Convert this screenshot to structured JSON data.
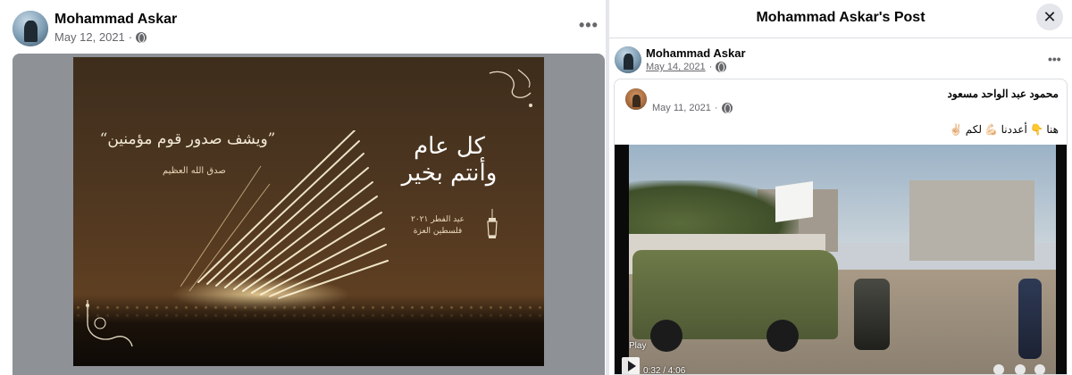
{
  "left_post": {
    "author": "Mohammad Askar",
    "date": "May 12, 2021",
    "separator": "·",
    "more": "•••",
    "image": {
      "quote": "“ويشف صدور قوم مؤمنين”",
      "quote_source": "صدق الله العظيم",
      "greeting": "كل عام وأنتم بخير",
      "eid_text_line1": "عيد الفطر ٢٠٢١",
      "eid_text_line2": "فلسطين العزة"
    }
  },
  "modal": {
    "title": "Mohammad Askar's Post",
    "close": "✕",
    "author": "Mohammad Askar",
    "date": "May 14, 2021",
    "separator": "·",
    "more": "•••",
    "shared_post": {
      "author": "محمود عبد الواحد مسعود",
      "date": "May 11, 2021",
      "separator": "·",
      "text": "هنا 👇 أعددنا 💪🏻 لكم ✌🏻",
      "video": {
        "play_label": "Play",
        "time": "0:32 / 4:06"
      }
    }
  },
  "colors": {
    "text_primary": "#050505",
    "text_secondary": "#65676b",
    "divider": "#e4e6eb",
    "close_bg": "#e4e6eb"
  },
  "icons": [
    "globe-icon",
    "more-icon",
    "close-icon",
    "play-icon",
    "lantern-icon",
    "ornament-icon"
  ]
}
